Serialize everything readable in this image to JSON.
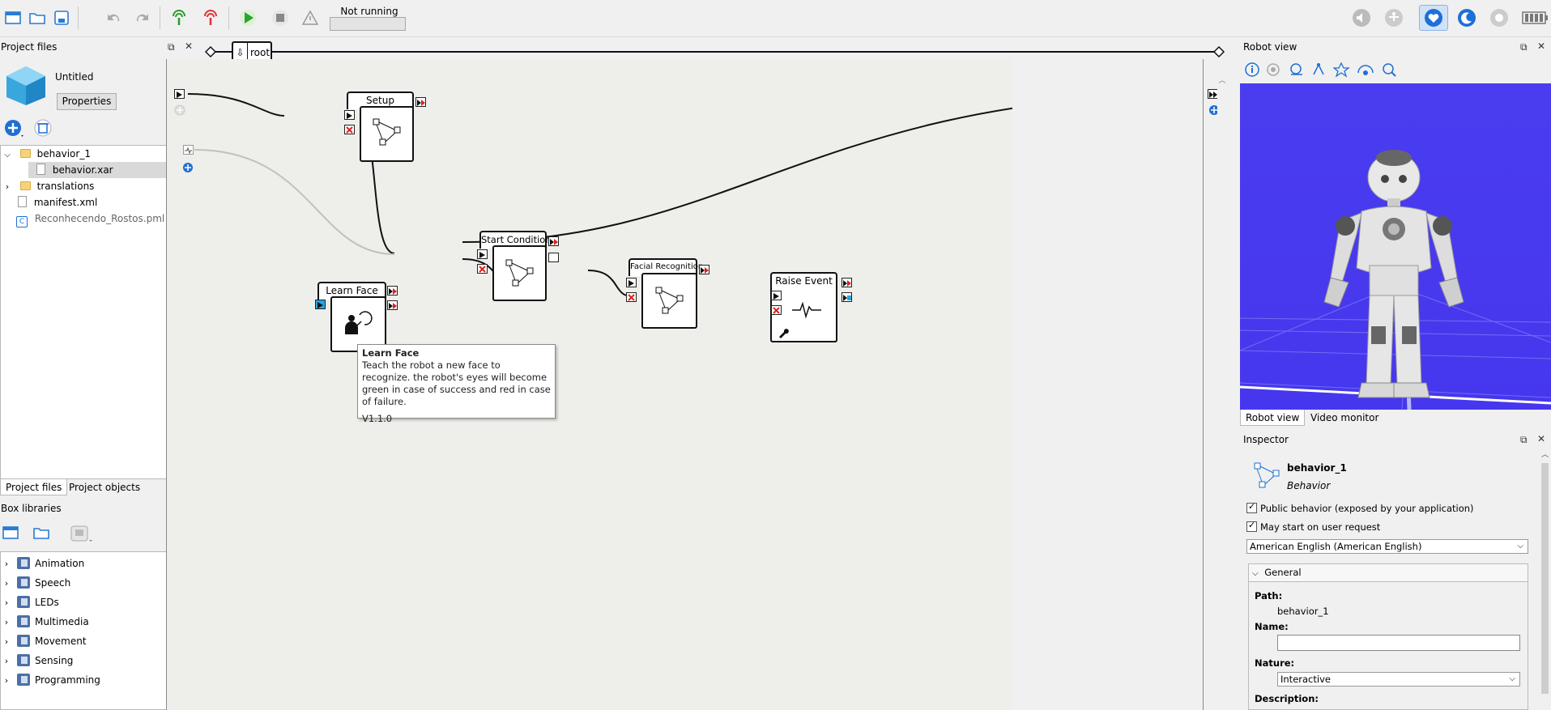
{
  "toolbar": {
    "status_text": "Not running",
    "left_icons": [
      "new-project-icon",
      "open-project-icon",
      "save-project-icon",
      "undo-icon",
      "redo-icon",
      "connect-icon",
      "disconnect-icon",
      "play-icon",
      "stop-icon",
      "warning-icon"
    ],
    "right_icons": [
      "volume-icon",
      "animation-mode-icon",
      "autonomous-life-icon",
      "rest-icon",
      "settings-icon",
      "battery-icon"
    ]
  },
  "project_files": {
    "title": "Project files",
    "project_name": "Untitled",
    "properties_button": "Properties",
    "tree": [
      {
        "label": "behavior_1",
        "type": "folder",
        "expanded": true
      },
      {
        "label": "behavior.xar",
        "type": "file",
        "selected": true
      },
      {
        "label": "translations",
        "type": "folder",
        "expanded": false
      },
      {
        "label": "manifest.xml",
        "type": "file"
      },
      {
        "label": "Reconhecendo_Rostos.pml",
        "type": "project"
      }
    ],
    "tabs": [
      "Project files",
      "Project objects"
    ]
  },
  "box_libraries": {
    "title": "Box libraries",
    "items": [
      "Animation",
      "Speech",
      "LEDs",
      "Multimedia",
      "Movement",
      "Sensing",
      "Programming"
    ]
  },
  "flow": {
    "breadcrumb": "root",
    "boxes": {
      "setup": "Setup",
      "start_condition": "Start Condition",
      "facial_recognition": "Facial Recognition",
      "raise_event": "Raise Event",
      "learn_face": "Learn Face"
    },
    "tooltip": {
      "title": "Learn Face",
      "body": "Teach the robot a new face to recognize. the robot's eyes will become green in case of success and red in case of failure.",
      "version": "V1.1.0"
    }
  },
  "robot_view": {
    "title": "Robot view",
    "tabs": [
      "Robot view",
      "Video monitor"
    ],
    "background_color": "#4433ee"
  },
  "inspector": {
    "title": "Inspector",
    "name": "behavior_1",
    "type": "Behavior",
    "public_behavior": "Public behavior (exposed by your application)",
    "may_start": "May start on user request",
    "language": "American English (American English)",
    "general_section": "General",
    "path_label": "Path:",
    "path_value": "behavior_1",
    "name_label": "Name:",
    "name_value": "",
    "nature_label": "Nature:",
    "nature_value": "Interactive",
    "description_label": "Description:"
  }
}
